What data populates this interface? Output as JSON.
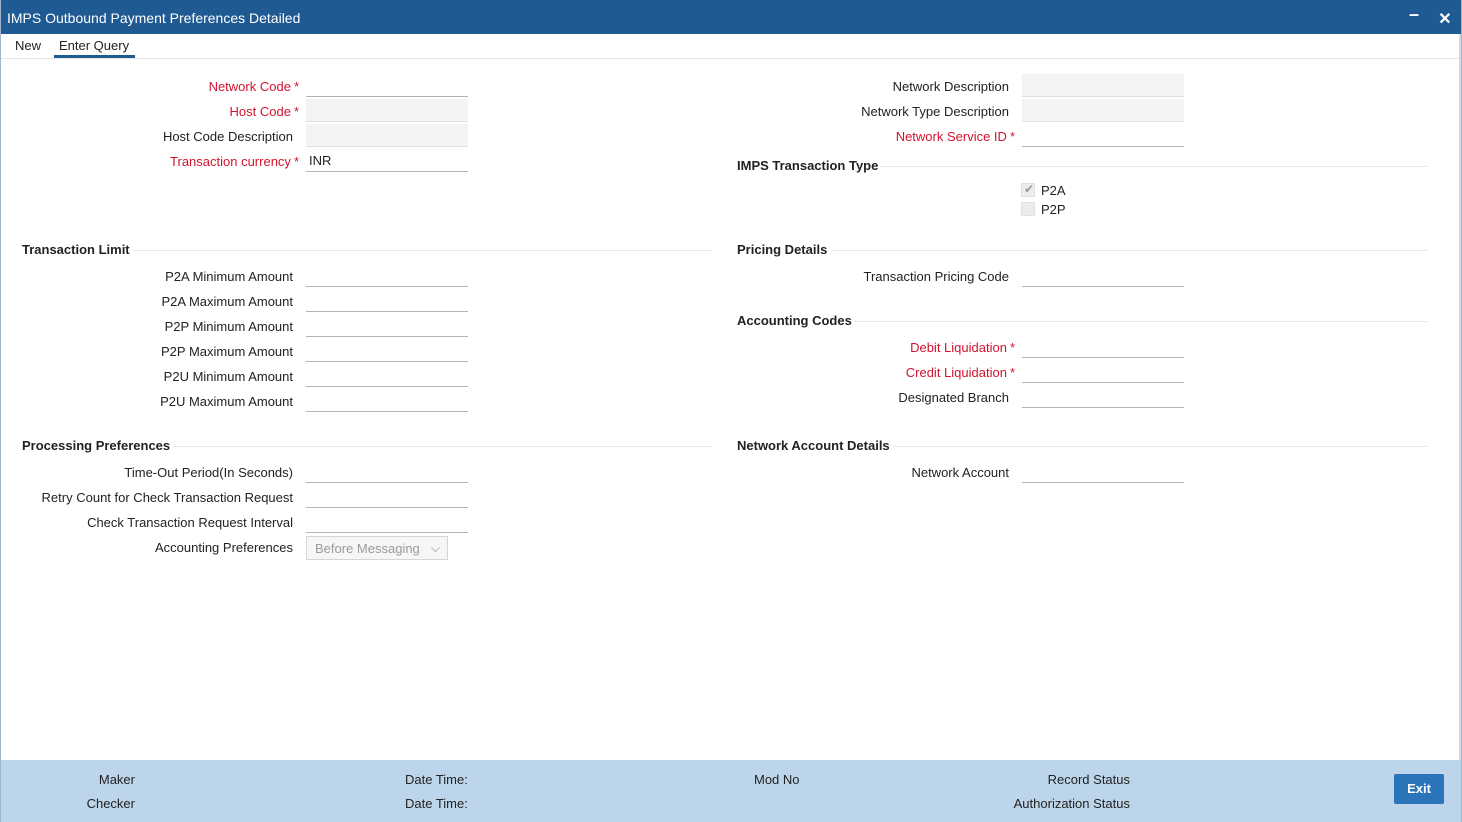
{
  "window": {
    "title": "IMPS Outbound Payment Preferences Detailed",
    "minimize_icon": "minimize-icon",
    "close_icon": "close-icon"
  },
  "toolbar": {
    "new_label": "New",
    "enter_query_label": "Enter Query"
  },
  "left": {
    "network_code_label": "Network Code",
    "host_code_label": "Host Code",
    "host_code_description_label": "Host Code Description",
    "transaction_currency_label": "Transaction currency",
    "transaction_currency_value": "INR"
  },
  "right": {
    "network_description_label": "Network Description",
    "network_type_description_label": "Network Type Description",
    "network_service_id_label": "Network Service ID"
  },
  "imps_transaction_type": {
    "title": "IMPS Transaction Type",
    "p2a_label": "P2A",
    "p2a_checked": true,
    "p2p_label": "P2P",
    "p2p_checked": false
  },
  "transaction_limit": {
    "title": "Transaction Limit",
    "p2a_min_label": "P2A Minimum Amount",
    "p2a_max_label": "P2A Maximum Amount",
    "p2p_min_label": "P2P Minimum Amount",
    "p2p_max_label": "P2P Maximum Amount",
    "p2u_min_label": "P2U Minimum Amount",
    "p2u_max_label": "P2U Maximum Amount"
  },
  "pricing_details": {
    "title": "Pricing Details",
    "transaction_pricing_code_label": "Transaction Pricing Code"
  },
  "accounting_codes": {
    "title": "Accounting Codes",
    "debit_liquidation_label": "Debit Liquidation",
    "credit_liquidation_label": "Credit Liquidation",
    "designated_branch_label": "Designated Branch"
  },
  "processing_preferences": {
    "title": "Processing Preferences",
    "timeout_label": "Time-Out Period(In Seconds)",
    "retry_count_label": "Retry Count for Check Transaction Request",
    "check_interval_label": "Check Transaction Request Interval",
    "accounting_preferences_label": "Accounting Preferences",
    "accounting_preferences_value": "Before Messaging"
  },
  "network_account_details": {
    "title": "Network Account Details",
    "network_account_label": "Network Account"
  },
  "footer": {
    "maker_label": "Maker",
    "checker_label": "Checker",
    "date_time_label_1": "Date Time:",
    "date_time_label_2": "Date Time:",
    "mod_no_label": "Mod No",
    "record_status_label": "Record Status",
    "authorization_status_label": "Authorization Status",
    "exit_label": "Exit"
  },
  "required_marker": "*",
  "colors": {
    "title_bar": "#1f5a93",
    "required": "#d3132e",
    "footer": "#bdd5ea",
    "exit_button": "#2a75b9"
  }
}
